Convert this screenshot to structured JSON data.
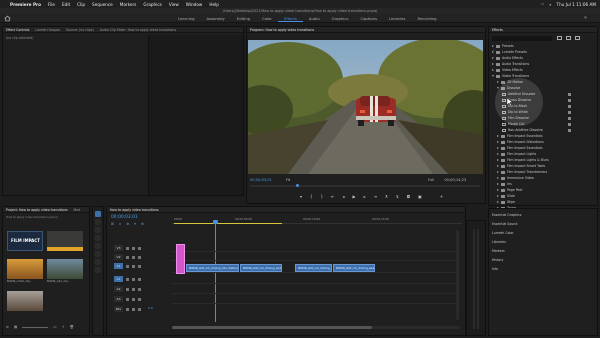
{
  "menubar": {
    "apple": "",
    "app": "Premiere Pro",
    "items": [
      "File",
      "Edit",
      "Clip",
      "Sequence",
      "Markers",
      "Graphics",
      "View",
      "Window",
      "Help"
    ],
    "clock": "Thu Jul 1  11:06 AM"
  },
  "titlebar": {
    "text": "/Users/j/Desktop/2021/How to apply video transitions/How to apply video transitions.prproj"
  },
  "workspaces": {
    "items": [
      "Learning",
      "Assembly",
      "Editing",
      "Color",
      "Effects",
      "Audio",
      "Graphics",
      "Captions",
      "Libraries",
      "Recording"
    ],
    "active": "Effects"
  },
  "source_panel": {
    "tabs": [
      "Effect Controls",
      "Lumetri Scopes",
      "Source: (no clips)",
      "Audio Clip Mixer: How to apply video transitions"
    ],
    "empty_text": "(no clip selected)"
  },
  "program": {
    "title": "Program: How to apply video transitions",
    "timecode_in": "00;00;03;01",
    "fit": "Fit",
    "quality": "Full",
    "timecode_out": "00;00;14;23"
  },
  "effects_panel": {
    "title": "Effects",
    "search_placeholder": "",
    "items": [
      {
        "label": "Presets",
        "type": "folder",
        "level": 0,
        "open": false
      },
      {
        "label": "Lumetri Presets",
        "type": "folder",
        "level": 0,
        "open": false
      },
      {
        "label": "Audio Effects",
        "type": "folder",
        "level": 0,
        "open": false
      },
      {
        "label": "Audio Transitions",
        "type": "folder",
        "level": 0,
        "open": false
      },
      {
        "label": "Video Effects",
        "type": "folder",
        "level": 0,
        "open": false
      },
      {
        "label": "Video Transitions",
        "type": "folder",
        "level": 0,
        "open": true
      },
      {
        "label": "3D Motion",
        "type": "folder",
        "level": 1,
        "open": false
      },
      {
        "label": "Dissolve",
        "type": "folder",
        "level": 1,
        "open": true
      },
      {
        "label": "Additive Dissolve",
        "type": "fx",
        "level": 2
      },
      {
        "label": "Cross Dissolve",
        "type": "fx",
        "level": 2
      },
      {
        "label": "Dip to Black",
        "type": "fx",
        "level": 2
      },
      {
        "label": "Dip to White",
        "type": "fx",
        "level": 2
      },
      {
        "label": "Film Dissolve",
        "type": "fx",
        "level": 2
      },
      {
        "label": "Morph Cut",
        "type": "fx",
        "level": 2
      },
      {
        "label": "Non-Additive Dissolve",
        "type": "fx",
        "level": 2
      },
      {
        "label": "Film Impact Essentials",
        "type": "folder",
        "level": 1,
        "open": false
      },
      {
        "label": "Film Impact Distortions",
        "type": "folder",
        "level": 1,
        "open": false
      },
      {
        "label": "Film Impact Essentials",
        "type": "folder",
        "level": 1,
        "open": false
      },
      {
        "label": "Film Impact Lights",
        "type": "folder",
        "level": 1,
        "open": false
      },
      {
        "label": "Film Impact Lights & Blurs",
        "type": "folder",
        "level": 1,
        "open": false
      },
      {
        "label": "Film Impact Smart Tools",
        "type": "folder",
        "level": 1,
        "open": false
      },
      {
        "label": "Film Impact Transformers",
        "type": "folder",
        "level": 1,
        "open": false
      },
      {
        "label": "Immersive Video",
        "type": "folder",
        "level": 1,
        "open": false
      },
      {
        "label": "Iris",
        "type": "folder",
        "level": 1,
        "open": false
      },
      {
        "label": "Page Peel",
        "type": "folder",
        "level": 1,
        "open": false
      },
      {
        "label": "Slide",
        "type": "folder",
        "level": 1,
        "open": false
      },
      {
        "label": "Wipe",
        "type": "folder",
        "level": 1,
        "open": false
      },
      {
        "label": "Zoom",
        "type": "folder",
        "level": 1,
        "open": false
      }
    ],
    "subpanels": [
      "Essential Graphics",
      "Essential Sound",
      "Lumetri Color",
      "Libraries",
      "Markers",
      "History",
      "Info"
    ]
  },
  "project": {
    "tabs": [
      "Project: How to apply video transitions",
      "Med"
    ],
    "file": "How to apply video transitions.prproj",
    "items": [
      {
        "name": "FILM IMPACT",
        "dur": ""
      },
      {
        "name": "",
        "dur": ""
      },
      {
        "name": "NIXON_rolled_clip...",
        "dur": "1:15"
      },
      {
        "name": "NIXON_wild_clip...",
        "dur": "3:13"
      },
      {
        "name": "",
        "dur": ""
      }
    ]
  },
  "timeline": {
    "title": "How to apply video transitions",
    "timecode": "00;00;03;01",
    "ruler": [
      "00;00",
      "00;00;05;00",
      "00;00;10;00",
      "00;00;15;00"
    ],
    "tracks": [
      {
        "id": "V3",
        "toggle": "V3"
      },
      {
        "id": "V2",
        "toggle": "V2"
      },
      {
        "id": "V1",
        "toggle": "V1"
      },
      {
        "id": "A1",
        "toggle": "A1"
      },
      {
        "id": "A2",
        "toggle": "A2"
      },
      {
        "id": "A3",
        "toggle": "A3"
      },
      {
        "id": "Mix",
        "toggle": "Mix"
      }
    ],
    "clips": [
      "NIXON_wild_car_driving_into_distance",
      "NIXON_wild_car_driving_away_fast",
      "NIXON_wild_car_driving_away",
      "NIXON_wild_car_driving_away"
    ],
    "mix_value": "0.0"
  },
  "colors": {
    "accent": "#4a90e2",
    "clip": "#3a6fb0",
    "pink": "#d058c8"
  }
}
